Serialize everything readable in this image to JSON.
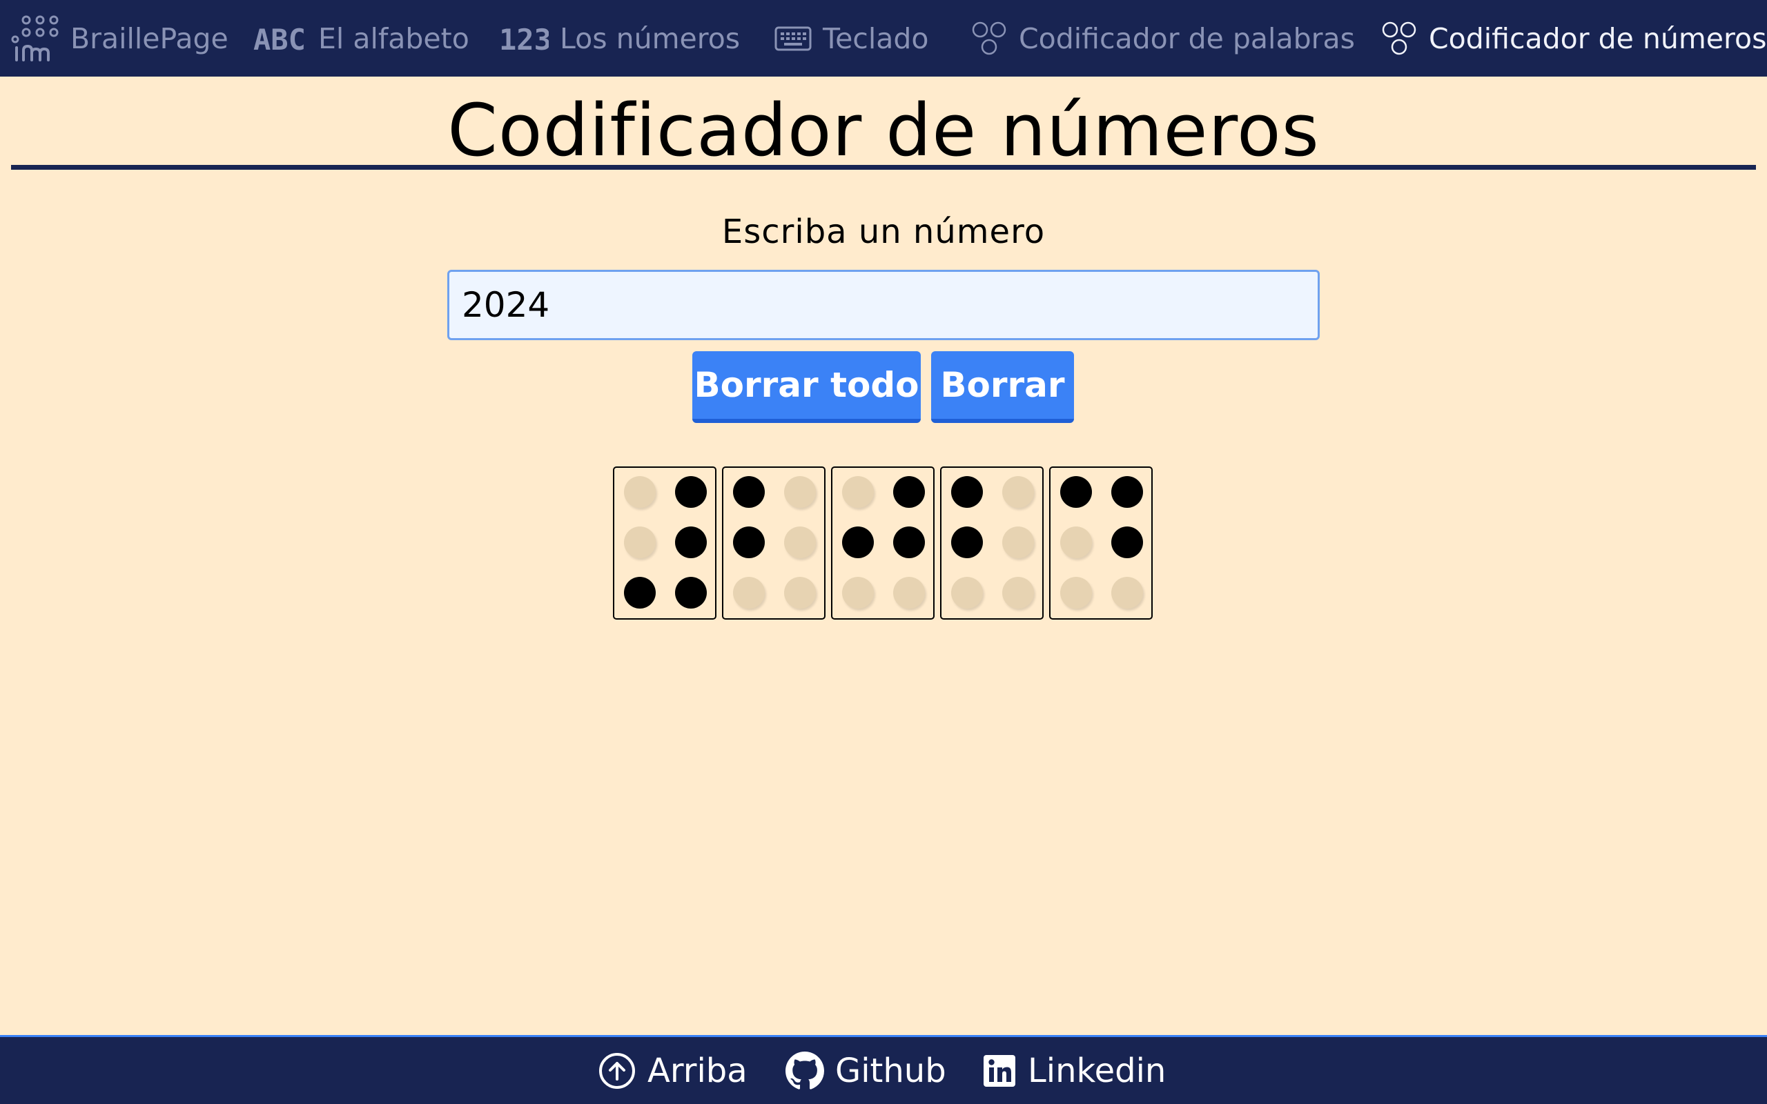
{
  "nav": {
    "items": [
      {
        "label": "BraillePage",
        "icon": "braille-logo-icon",
        "active": false
      },
      {
        "label": "El alfabeto",
        "icon": "abc-icon",
        "active": false
      },
      {
        "label": "Los números",
        "icon": "123-icon",
        "active": false
      },
      {
        "label": "Teclado",
        "icon": "keyboard-icon",
        "active": false
      },
      {
        "label": "Codificador de palabras",
        "icon": "braille-dots-icon",
        "active": false
      },
      {
        "label": "Codificador de números",
        "icon": "braille-dots-icon",
        "active": true
      }
    ]
  },
  "main": {
    "title": "Codificador de números",
    "input_label": "Escriba un número",
    "input_value": "2024",
    "buttons": {
      "clear_all": "Borrar todo",
      "clear": "Borrar"
    },
    "braille_cells": [
      {
        "char": "#",
        "dots": [
          3,
          4,
          5,
          6
        ]
      },
      {
        "char": "2",
        "dots": [
          1,
          2
        ]
      },
      {
        "char": "0",
        "dots": [
          2,
          4,
          5
        ]
      },
      {
        "char": "2",
        "dots": [
          1,
          2
        ]
      },
      {
        "char": "4",
        "dots": [
          1,
          4,
          5
        ]
      }
    ]
  },
  "footer": {
    "links": [
      {
        "label": "Arriba",
        "icon": "arrow-up-circle-icon"
      },
      {
        "label": "Github",
        "icon": "github-icon"
      },
      {
        "label": "Linkedin",
        "icon": "linkedin-icon"
      }
    ]
  },
  "colors": {
    "nav_bg": "#182452",
    "page_bg": "#ffebcd",
    "button": "#3b82f6",
    "dot_on": "#000000",
    "dot_off": "#e7d3b2"
  }
}
